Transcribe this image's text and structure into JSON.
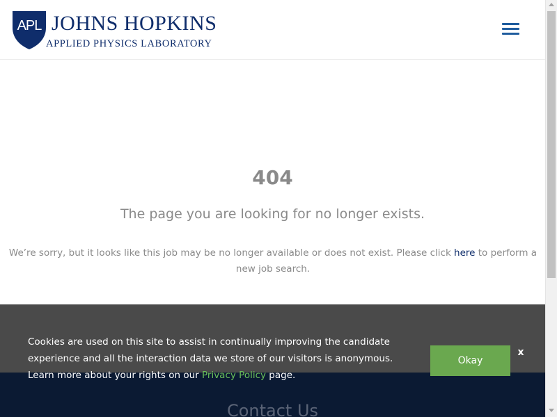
{
  "header": {
    "logo": {
      "shield_text": "APL",
      "title": "JOHNS HOPKINS",
      "subtitle": "APPLIED PHYSICS LABORATORY",
      "icon": "shield-icon"
    },
    "menu_icon": "hamburger-menu-icon"
  },
  "main": {
    "error_code": "404",
    "heading": "The page you are looking for no longer exists.",
    "message_before": "We’re sorry, but it looks like this job may be no longer available or does not exist. Please click ",
    "message_link": "here",
    "message_after": " to perform a new job search."
  },
  "footer": {
    "contact_heading": "Contact Us"
  },
  "cookie_banner": {
    "text_before": "Cookies are used on this site to assist in continually improving the candidate experience and all the interaction data we store of our visitors is anonymous. Learn more about your rights on our ",
    "link_label": "Privacy Policy",
    "text_after": " page.",
    "okay_label": "Okay",
    "close_label": "x"
  },
  "colors": {
    "brand_navy": "#0f2d6b",
    "menu_blue": "#1f5c9e",
    "text_gray": "#8a8a8a",
    "footer_navy": "#0b1a33",
    "banner_gray": "#4a4a4a",
    "okay_green": "#6aa84f",
    "link_green": "#6abf5a"
  }
}
